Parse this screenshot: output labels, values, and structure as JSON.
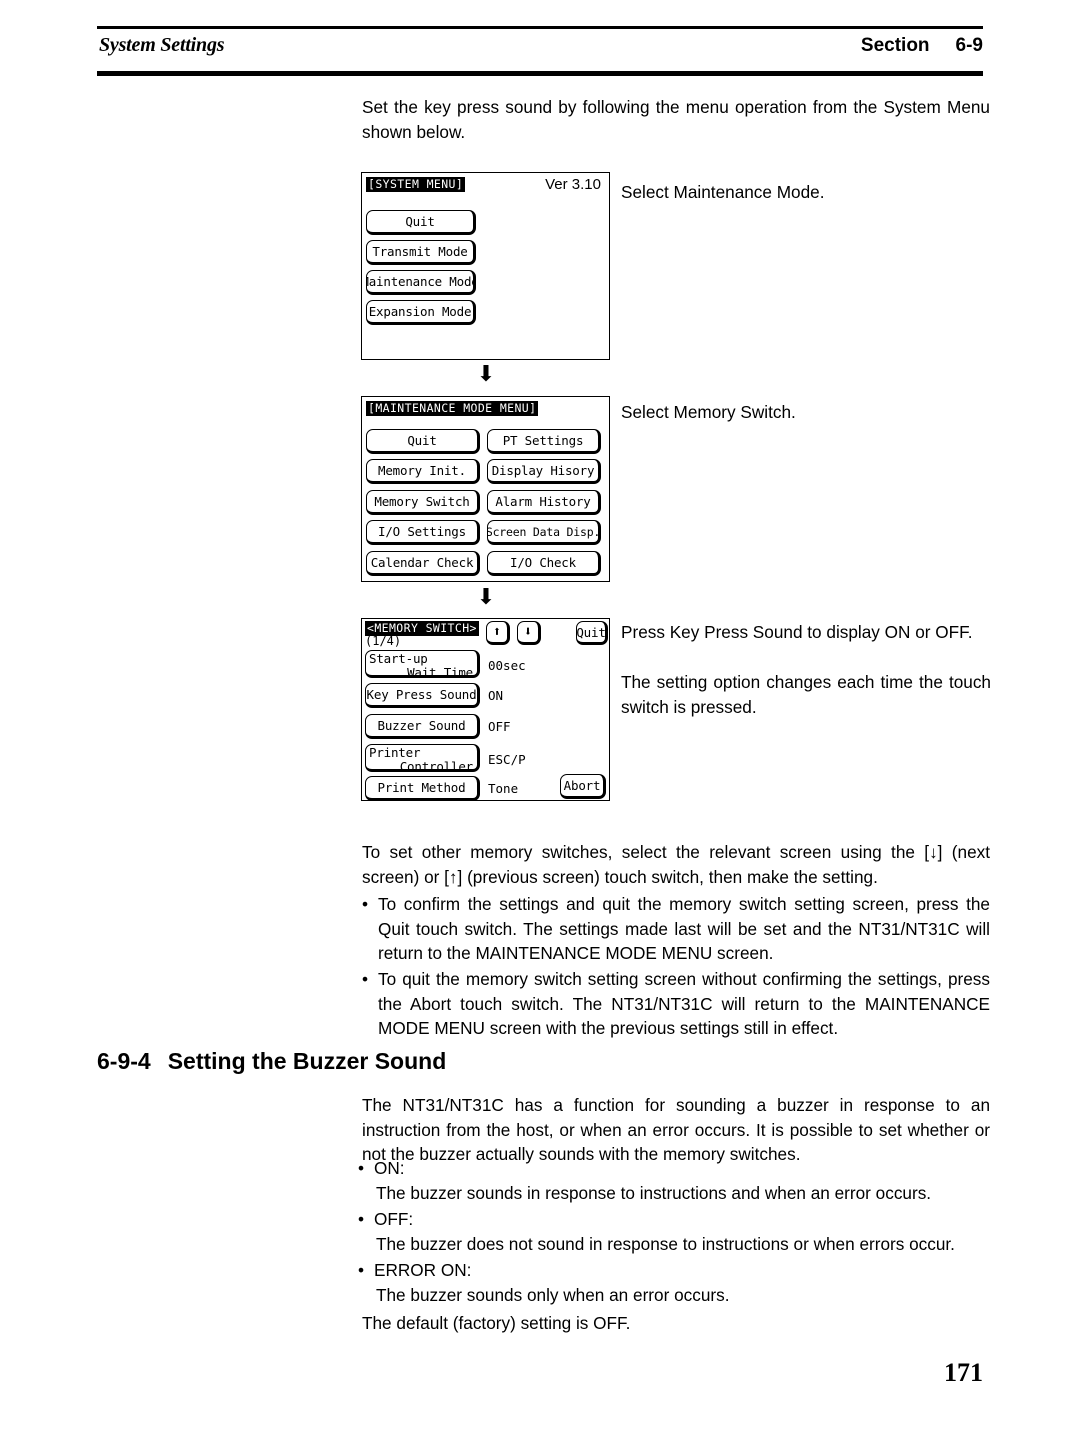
{
  "header": {
    "left_title": "System Settings",
    "section_label": "Section",
    "section_number": "6-9"
  },
  "intro": {
    "paragraph": "Set the key press sound by following the menu operation from the System Menu shown below."
  },
  "screens": {
    "system_menu": {
      "title": "[SYSTEM MENU]",
      "version": "Ver 3.10",
      "buttons": [
        "Quit",
        "Transmit Mode",
        "Maintenance Mode",
        "Expansion Mode"
      ],
      "caption": "Select Maintenance Mode."
    },
    "maintenance_menu": {
      "title": "[MAINTENANCE MODE MENU]",
      "buttons_left": [
        "Quit",
        "Memory Init.",
        "Memory Switch",
        "I/O Settings",
        "Calendar Check"
      ],
      "buttons_right": [
        "PT Settings",
        "Display Hisory",
        "Alarm History",
        "Screen Data Disp.",
        "I/O Check"
      ],
      "caption": "Select Memory Switch."
    },
    "memory_switch": {
      "title": "<MEMORY SWITCH>",
      "page_indicator": "(1/4)",
      "up_icon": "arrow-up-icon",
      "down_icon": "arrow-down-icon",
      "quit_label": "Quit",
      "abort_label": "Abort",
      "rows": [
        {
          "label_line1": "Start-up",
          "label_line2": "Wait Time",
          "value": "00sec"
        },
        {
          "label_line1": "Key Press Sound",
          "label_line2": "",
          "value": "ON"
        },
        {
          "label_line1": "Buzzer Sound",
          "label_line2": "",
          "value": "OFF"
        },
        {
          "label_line1": "Printer",
          "label_line2": "Controller",
          "value": "ESC/P"
        },
        {
          "label_line1": "Print Method",
          "label_line2": "",
          "value": "Tone"
        }
      ],
      "caption_1": "Press Key Press Sound to display ON or OFF.",
      "caption_2": "The setting option changes each time the touch switch is pressed."
    }
  },
  "notes": {
    "other_switches": "To set other memory switches, select the relevant screen using the [↓] (next screen) or [↑] (previous screen) touch switch, then make the setting.",
    "bullets": [
      "To confirm the settings and quit the memory switch setting screen, press the Quit touch switch. The settings made last will be set and the NT31/NT31C will return to the MAINTENANCE MODE MENU screen.",
      "To quit the memory switch setting screen without confirming the settings, press the Abort touch switch. The NT31/NT31C will return to the MAINTENANCE MODE MENU screen with the previous settings still in effect."
    ]
  },
  "section": {
    "number": "6-9-4",
    "title": "Setting the Buzzer Sound",
    "intro": "The NT31/NT31C has a function for sounding a buzzer in response to an instruction from the host, or when an error occurs. It is possible to set whether or not the buzzer actually sounds with the memory switches.",
    "options": [
      {
        "name": "ON:",
        "description": "The buzzer sounds in response to instructions and when an error occurs."
      },
      {
        "name": "OFF:",
        "description": "The buzzer does not sound in response to instructions or when errors occur."
      },
      {
        "name": "ERROR ON:",
        "description": "The buzzer sounds only when an error occurs."
      }
    ],
    "default_note": "The default (factory) setting is OFF."
  },
  "page_number": "171"
}
